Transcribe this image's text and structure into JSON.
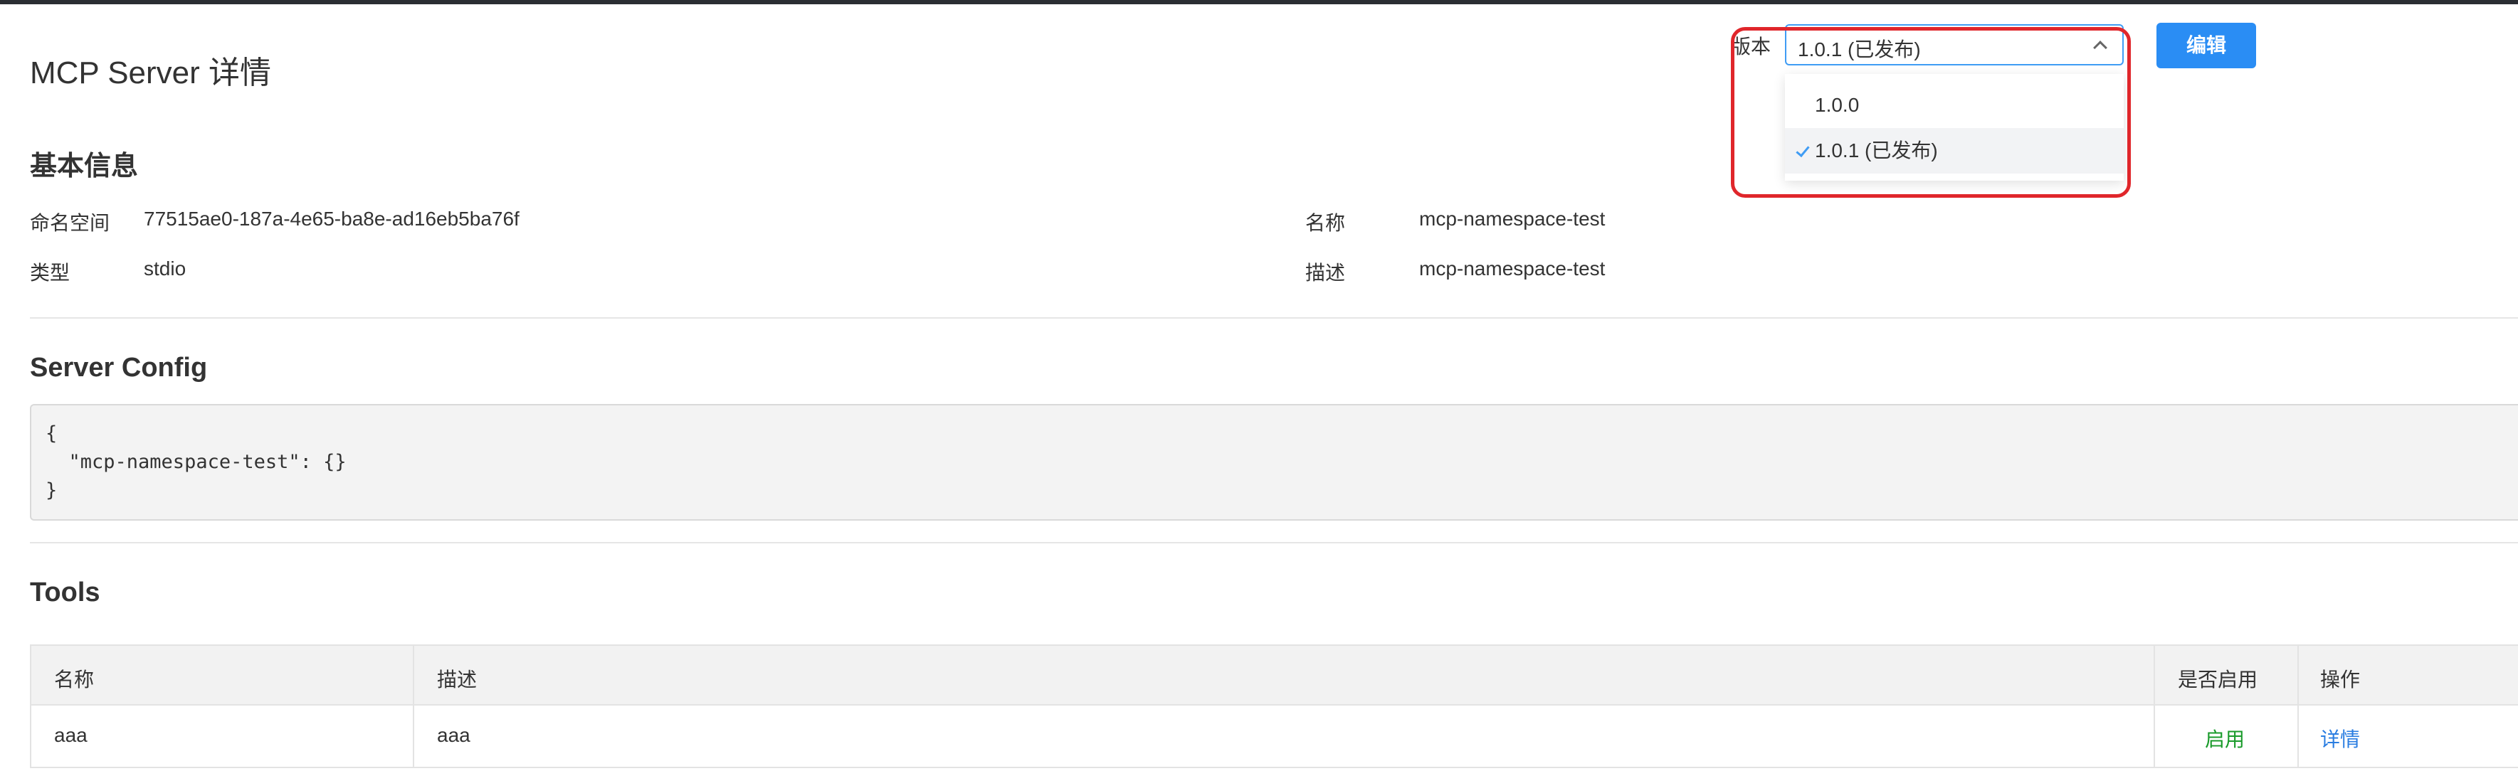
{
  "page": {
    "title": "MCP Server 详情"
  },
  "version": {
    "label": "版本",
    "selected": "1.0.1 (已发布)",
    "options": [
      "1.0.0",
      "1.0.1 (已发布)"
    ]
  },
  "actions": {
    "edit_label": "编辑"
  },
  "basic_info": {
    "title": "基本信息",
    "namespace_label": "命名空间",
    "namespace_value": "77515ae0-187a-4e65-ba8e-ad16eb5ba76f",
    "name_label": "名称",
    "name_value": "mcp-namespace-test",
    "type_label": "类型",
    "type_value": "stdio",
    "description_label": "描述",
    "description_value": "mcp-namespace-test"
  },
  "server_config": {
    "title": "Server Config",
    "code": "{\n  \"mcp-namespace-test\": {}\n}"
  },
  "tools": {
    "title": "Tools",
    "columns": [
      "名称",
      "描述",
      "是否启用",
      "操作"
    ],
    "rows": [
      {
        "name": "aaa",
        "description": "aaa",
        "enabled": "启用",
        "action": "详情"
      }
    ]
  },
  "colors": {
    "accent": "#2a8df4",
    "highlight": "#e0262b",
    "enabled": "#1a9b2b",
    "link": "#2a7de1"
  }
}
